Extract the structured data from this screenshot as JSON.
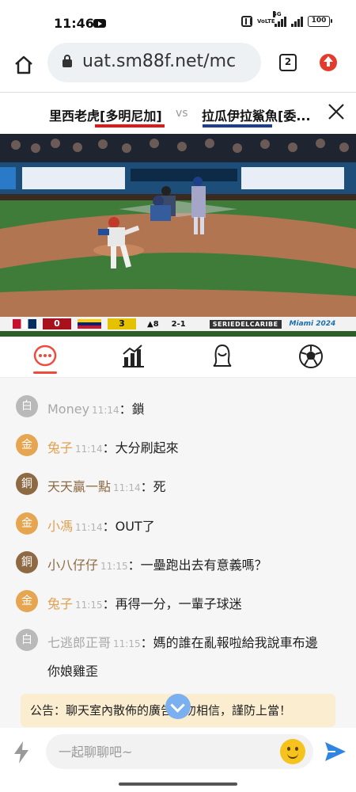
{
  "status_bar": {
    "time": "11:46",
    "battery": "100",
    "network": "5G",
    "volte": "VoLTE"
  },
  "browser": {
    "url": "uat.sm88f.net/mc",
    "tab_count": "2"
  },
  "match": {
    "home_team": "里西老虎[多明尼加]",
    "vs": "vs",
    "away_team": "拉瓜伊拉鯊魚[委..."
  },
  "scorebar": {
    "score1": "0",
    "score2": "3",
    "inning": "▲8",
    "count": "2-1",
    "series": "SERIEDELCARIBE",
    "year": "Miami 2024",
    "dr_color": "#c8102e",
    "ven_color": "#e5c200"
  },
  "tabs": [
    {
      "name": "chat",
      "icon": "chat-icon",
      "active": true
    },
    {
      "name": "stats",
      "icon": "chart-icon",
      "active": false
    },
    {
      "name": "anchor",
      "icon": "person-icon",
      "active": false
    },
    {
      "name": "games",
      "icon": "soccer-ball-icon",
      "active": false
    }
  ],
  "chat": {
    "messages": [
      {
        "badge": "白",
        "level": "silver",
        "user": "Money",
        "time": "11:14",
        "text": "鎖"
      },
      {
        "badge": "金",
        "level": "gold",
        "user": "兔子",
        "time": "11:14",
        "text": "大分刷起來"
      },
      {
        "badge": "銅",
        "level": "bronze",
        "user": "天天贏一點",
        "time": "11:14",
        "text": "死"
      },
      {
        "badge": "金",
        "level": "gold",
        "user": "小馮",
        "time": "11:14",
        "text": "OUT了"
      },
      {
        "badge": "銅",
        "level": "bronze",
        "user": "小八仔仔",
        "time": "11:15",
        "text": "一壘跑出去有意義嗎？"
      },
      {
        "badge": "金",
        "level": "gold",
        "user": "兔子",
        "time": "11:15",
        "text": "再得一分，一輩子球迷"
      },
      {
        "badge": "白",
        "level": "silver",
        "user": "七逃郎正哥",
        "time": "11:15",
        "text": "媽的誰在亂報啦給我說車布邊",
        "text_line2": "你娘雞歪"
      }
    ],
    "colon": "：",
    "notice": "公告：聊天室內散佈的廣告切勿相信，謹防上當！"
  },
  "input": {
    "placeholder": "一起聊聊吧~"
  }
}
